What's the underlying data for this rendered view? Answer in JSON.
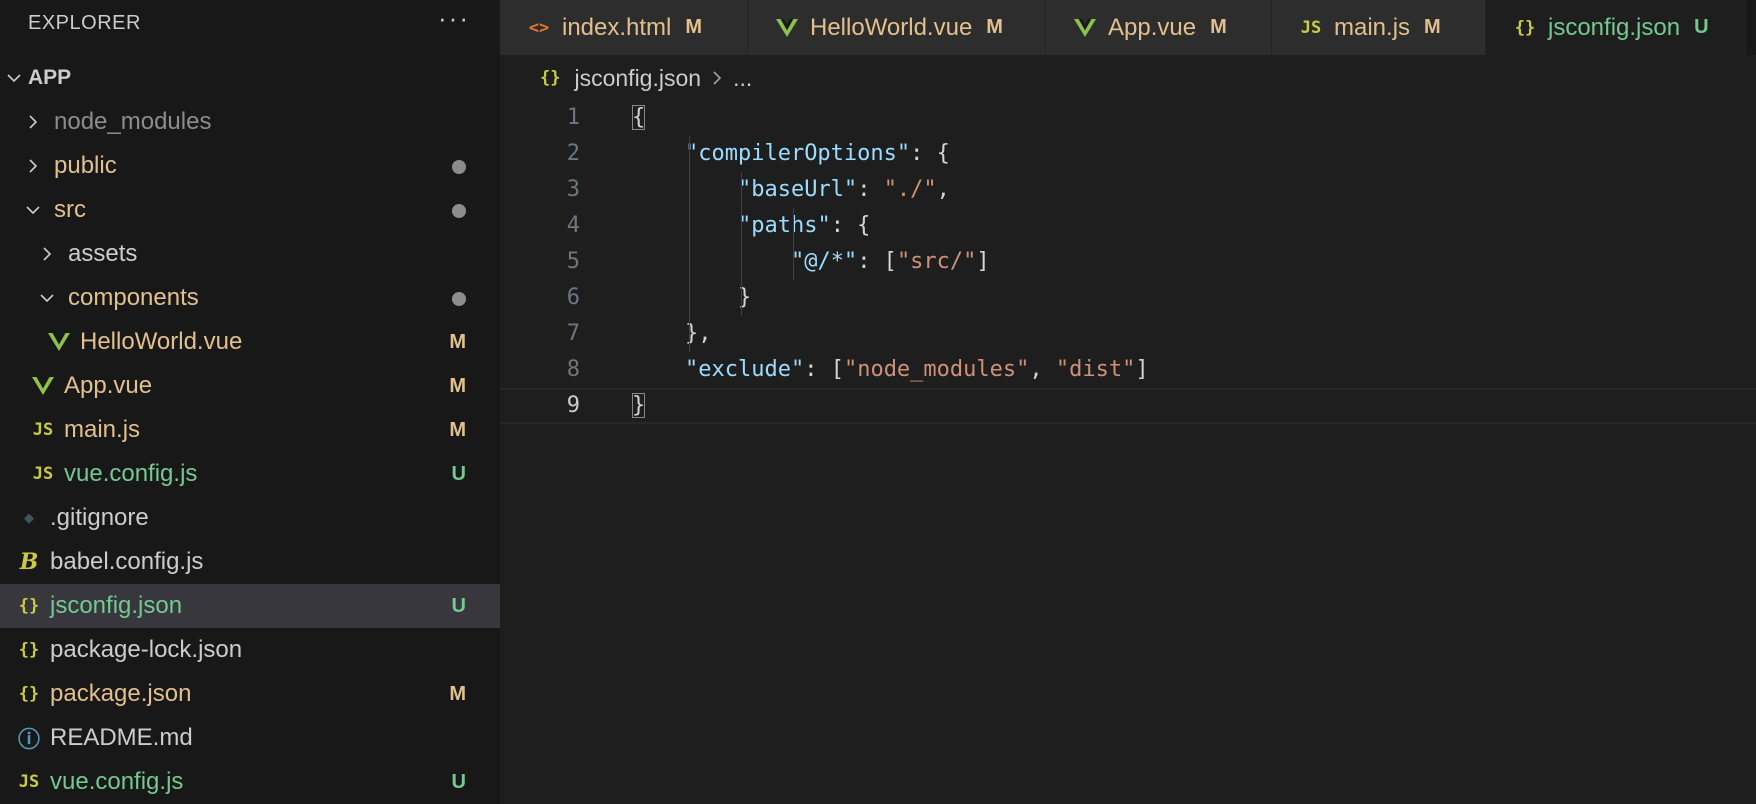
{
  "sidebar": {
    "title": "EXPLORER",
    "more_label": "···",
    "section": "APP",
    "tree": [
      {
        "label": "node_modules",
        "twisty": "right",
        "indent": 1,
        "color": "gray"
      },
      {
        "label": "public",
        "twisty": "right",
        "indent": 1,
        "color": "mod",
        "dot": true
      },
      {
        "label": "src",
        "twisty": "down",
        "indent": 1,
        "color": "mod",
        "dot": true
      },
      {
        "label": "assets",
        "twisty": "right",
        "indent": 2,
        "color": "def"
      },
      {
        "label": "components",
        "twisty": "down",
        "indent": 2,
        "color": "mod",
        "dot": true
      },
      {
        "label": "HelloWorld.vue",
        "icon": "vue-icon",
        "indent": 3,
        "color": "mod",
        "badge": "M"
      },
      {
        "label": "App.vue",
        "icon": "vue-icon",
        "indent": 2,
        "color": "mod",
        "badge": "M"
      },
      {
        "label": "main.js",
        "icon": "js-icon",
        "indent": 2,
        "color": "mod",
        "badge": "M"
      },
      {
        "label": "vue.config.js",
        "icon": "js-icon",
        "indent": 2,
        "color": "new",
        "badge": "U"
      },
      {
        "label": ".gitignore",
        "icon": "git-icon",
        "indent": 1,
        "color": "def"
      },
      {
        "label": "babel.config.js",
        "icon": "babel-icon",
        "indent": 1,
        "color": "def"
      },
      {
        "label": "jsconfig.json",
        "icon": "json-icon",
        "indent": 1,
        "color": "new",
        "badge": "U",
        "selected": true
      },
      {
        "label": "package-lock.json",
        "icon": "json-icon",
        "indent": 1,
        "color": "def"
      },
      {
        "label": "package.json",
        "icon": "json-icon",
        "indent": 1,
        "color": "mod",
        "badge": "M"
      },
      {
        "label": "README.md",
        "icon": "info-icon",
        "indent": 1,
        "color": "def"
      },
      {
        "label": "vue.config.js",
        "icon": "js-icon",
        "indent": 1,
        "color": "new",
        "badge": "U"
      }
    ]
  },
  "tabs": [
    {
      "label": "index.html",
      "icon": "html-icon",
      "badge": "M",
      "color": "mod"
    },
    {
      "label": "HelloWorld.vue",
      "icon": "vue-icon",
      "badge": "M",
      "color": "mod"
    },
    {
      "label": "App.vue",
      "icon": "vue-icon",
      "badge": "M",
      "color": "mod"
    },
    {
      "label": "main.js",
      "icon": "js-icon",
      "badge": "M",
      "color": "mod"
    },
    {
      "label": "jsconfig.json",
      "icon": "json-icon",
      "badge": "U",
      "color": "new",
      "active": true
    }
  ],
  "breadcrumb": {
    "file": "jsconfig.json",
    "more": "..."
  },
  "code_lines": [
    [
      {
        "t": "p",
        "v": "{",
        "bm": true
      }
    ],
    [
      {
        "t": "p",
        "v": "    "
      },
      {
        "t": "k",
        "v": "\"compilerOptions\""
      },
      {
        "t": "p",
        "v": ": {"
      }
    ],
    [
      {
        "t": "p",
        "v": "        "
      },
      {
        "t": "k",
        "v": "\"baseUrl\""
      },
      {
        "t": "p",
        "v": ": "
      },
      {
        "t": "s",
        "v": "\"./\""
      },
      {
        "t": "p",
        "v": ","
      }
    ],
    [
      {
        "t": "p",
        "v": "        "
      },
      {
        "t": "k",
        "v": "\"paths\""
      },
      {
        "t": "p",
        "v": ": {"
      }
    ],
    [
      {
        "t": "p",
        "v": "            "
      },
      {
        "t": "k",
        "v": "\"@/*\""
      },
      {
        "t": "p",
        "v": ": ["
      },
      {
        "t": "s",
        "v": "\"src/\""
      },
      {
        "t": "p",
        "v": "]"
      }
    ],
    [
      {
        "t": "p",
        "v": "        }"
      }
    ],
    [
      {
        "t": "p",
        "v": "    },"
      }
    ],
    [
      {
        "t": "p",
        "v": "    "
      },
      {
        "t": "k",
        "v": "\"exclude\""
      },
      {
        "t": "p",
        "v": ": ["
      },
      {
        "t": "s",
        "v": "\"node_modules\""
      },
      {
        "t": "p",
        "v": ", "
      },
      {
        "t": "s",
        "v": "\"dist\""
      },
      {
        "t": "p",
        "v": "]"
      }
    ],
    [
      {
        "t": "p",
        "v": "}",
        "bm": true
      }
    ]
  ],
  "current_line": 9,
  "icons": {
    "vue-icon": "V",
    "js-icon": "JS",
    "json-icon": "{}",
    "git-icon": "◆",
    "babel-icon": "B",
    "info-icon": "ⓘ",
    "html-icon": "<>"
  },
  "colors": {
    "modified": "#e2c08d",
    "untracked": "#73c991",
    "selected_bg": "#37373d",
    "editor_bg": "#1e1e1e",
    "sidebar_bg": "#181818"
  }
}
